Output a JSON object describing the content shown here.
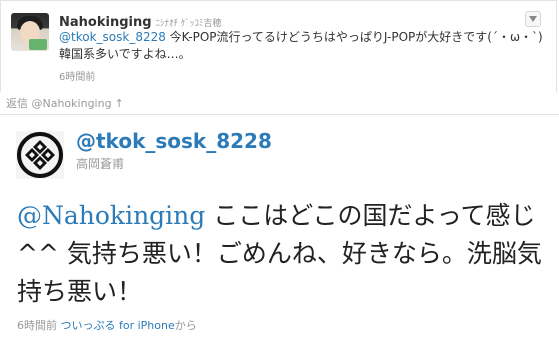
{
  "reply_tweet": {
    "screen_name": "Nahokinging",
    "full_name": "ﾆｼﾅｵﾁ ｹﾞｯｺﾐ吉穂",
    "mention": "@tkok_sosk_8228",
    "text_line1": " 今K-POP流行ってるけどうちはやっぱりJ-POPが大好きです(´・ω・`)",
    "text_line2": "韓国系多いですよね…。",
    "time": "6時間前",
    "menu_icon": "chevron-down-icon"
  },
  "in_reply_to": {
    "label": "返信 @Nahokinging",
    "arrow": "↑"
  },
  "main_tweet": {
    "screen_name": "@tkok_sosk_8228",
    "full_name": "高岡蒼甫",
    "mention": "@Nahokinging",
    "text": " ここはどこの国だよって感じ^^ 気持ち悪い！ごめんね、好きなら。洗脳気持ち悪い！",
    "time": "6時間前",
    "via": "ついっぷる for iPhone",
    "via_suffix": "から"
  },
  "colors": {
    "link": "#2b7bb9",
    "muted": "#999999",
    "text": "#333333"
  }
}
